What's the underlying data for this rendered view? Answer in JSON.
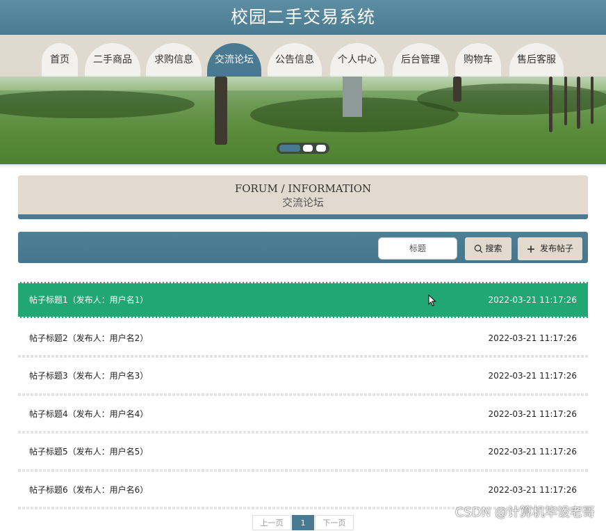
{
  "site": {
    "title": "校园二手交易系统"
  },
  "nav": {
    "items": [
      {
        "label": "首页",
        "active": false
      },
      {
        "label": "二手商品",
        "active": false
      },
      {
        "label": "求购信息",
        "active": false
      },
      {
        "label": "交流论坛",
        "active": true
      },
      {
        "label": "公告信息",
        "active": false
      },
      {
        "label": "个人中心",
        "active": false
      },
      {
        "label": "后台管理",
        "active": false
      },
      {
        "label": "购物车",
        "active": false
      },
      {
        "label": "售后客服",
        "active": false
      }
    ]
  },
  "banner": {
    "slide_count": 3,
    "active_slide": 1
  },
  "section": {
    "title_en": "FORUM / INFORMATION",
    "title_cn": "交流论坛"
  },
  "toolbar": {
    "search_placeholder": "标题",
    "search_label": "搜索",
    "post_label": "发布帖子"
  },
  "posts": [
    {
      "title": "帖子标题1（发布人：用户名1）",
      "time": "2022-03-21 11:17:26",
      "highlighted": true
    },
    {
      "title": "帖子标题2（发布人：用户名2）",
      "time": "2022-03-21 11:17:26",
      "highlighted": false
    },
    {
      "title": "帖子标题3（发布人：用户名3）",
      "time": "2022-03-21 11:17:26",
      "highlighted": false
    },
    {
      "title": "帖子标题4（发布人：用户名4）",
      "time": "2022-03-21 11:17:26",
      "highlighted": false
    },
    {
      "title": "帖子标题5（发布人：用户名5）",
      "time": "2022-03-21 11:17:26",
      "highlighted": false
    },
    {
      "title": "帖子标题6（发布人：用户名6）",
      "time": "2022-03-21 11:17:26",
      "highlighted": false
    }
  ],
  "pagination": {
    "prev_label": "上一页",
    "current_page": "1",
    "next_label": "下一页"
  },
  "watermark": "CSDN @计算机毕设老哥",
  "colors": {
    "header": "#4a7b90",
    "accent": "#4a7a92",
    "nav_band": "#e0d9cf",
    "highlight_row": "#20a773",
    "button_bg": "#e3dacf"
  }
}
